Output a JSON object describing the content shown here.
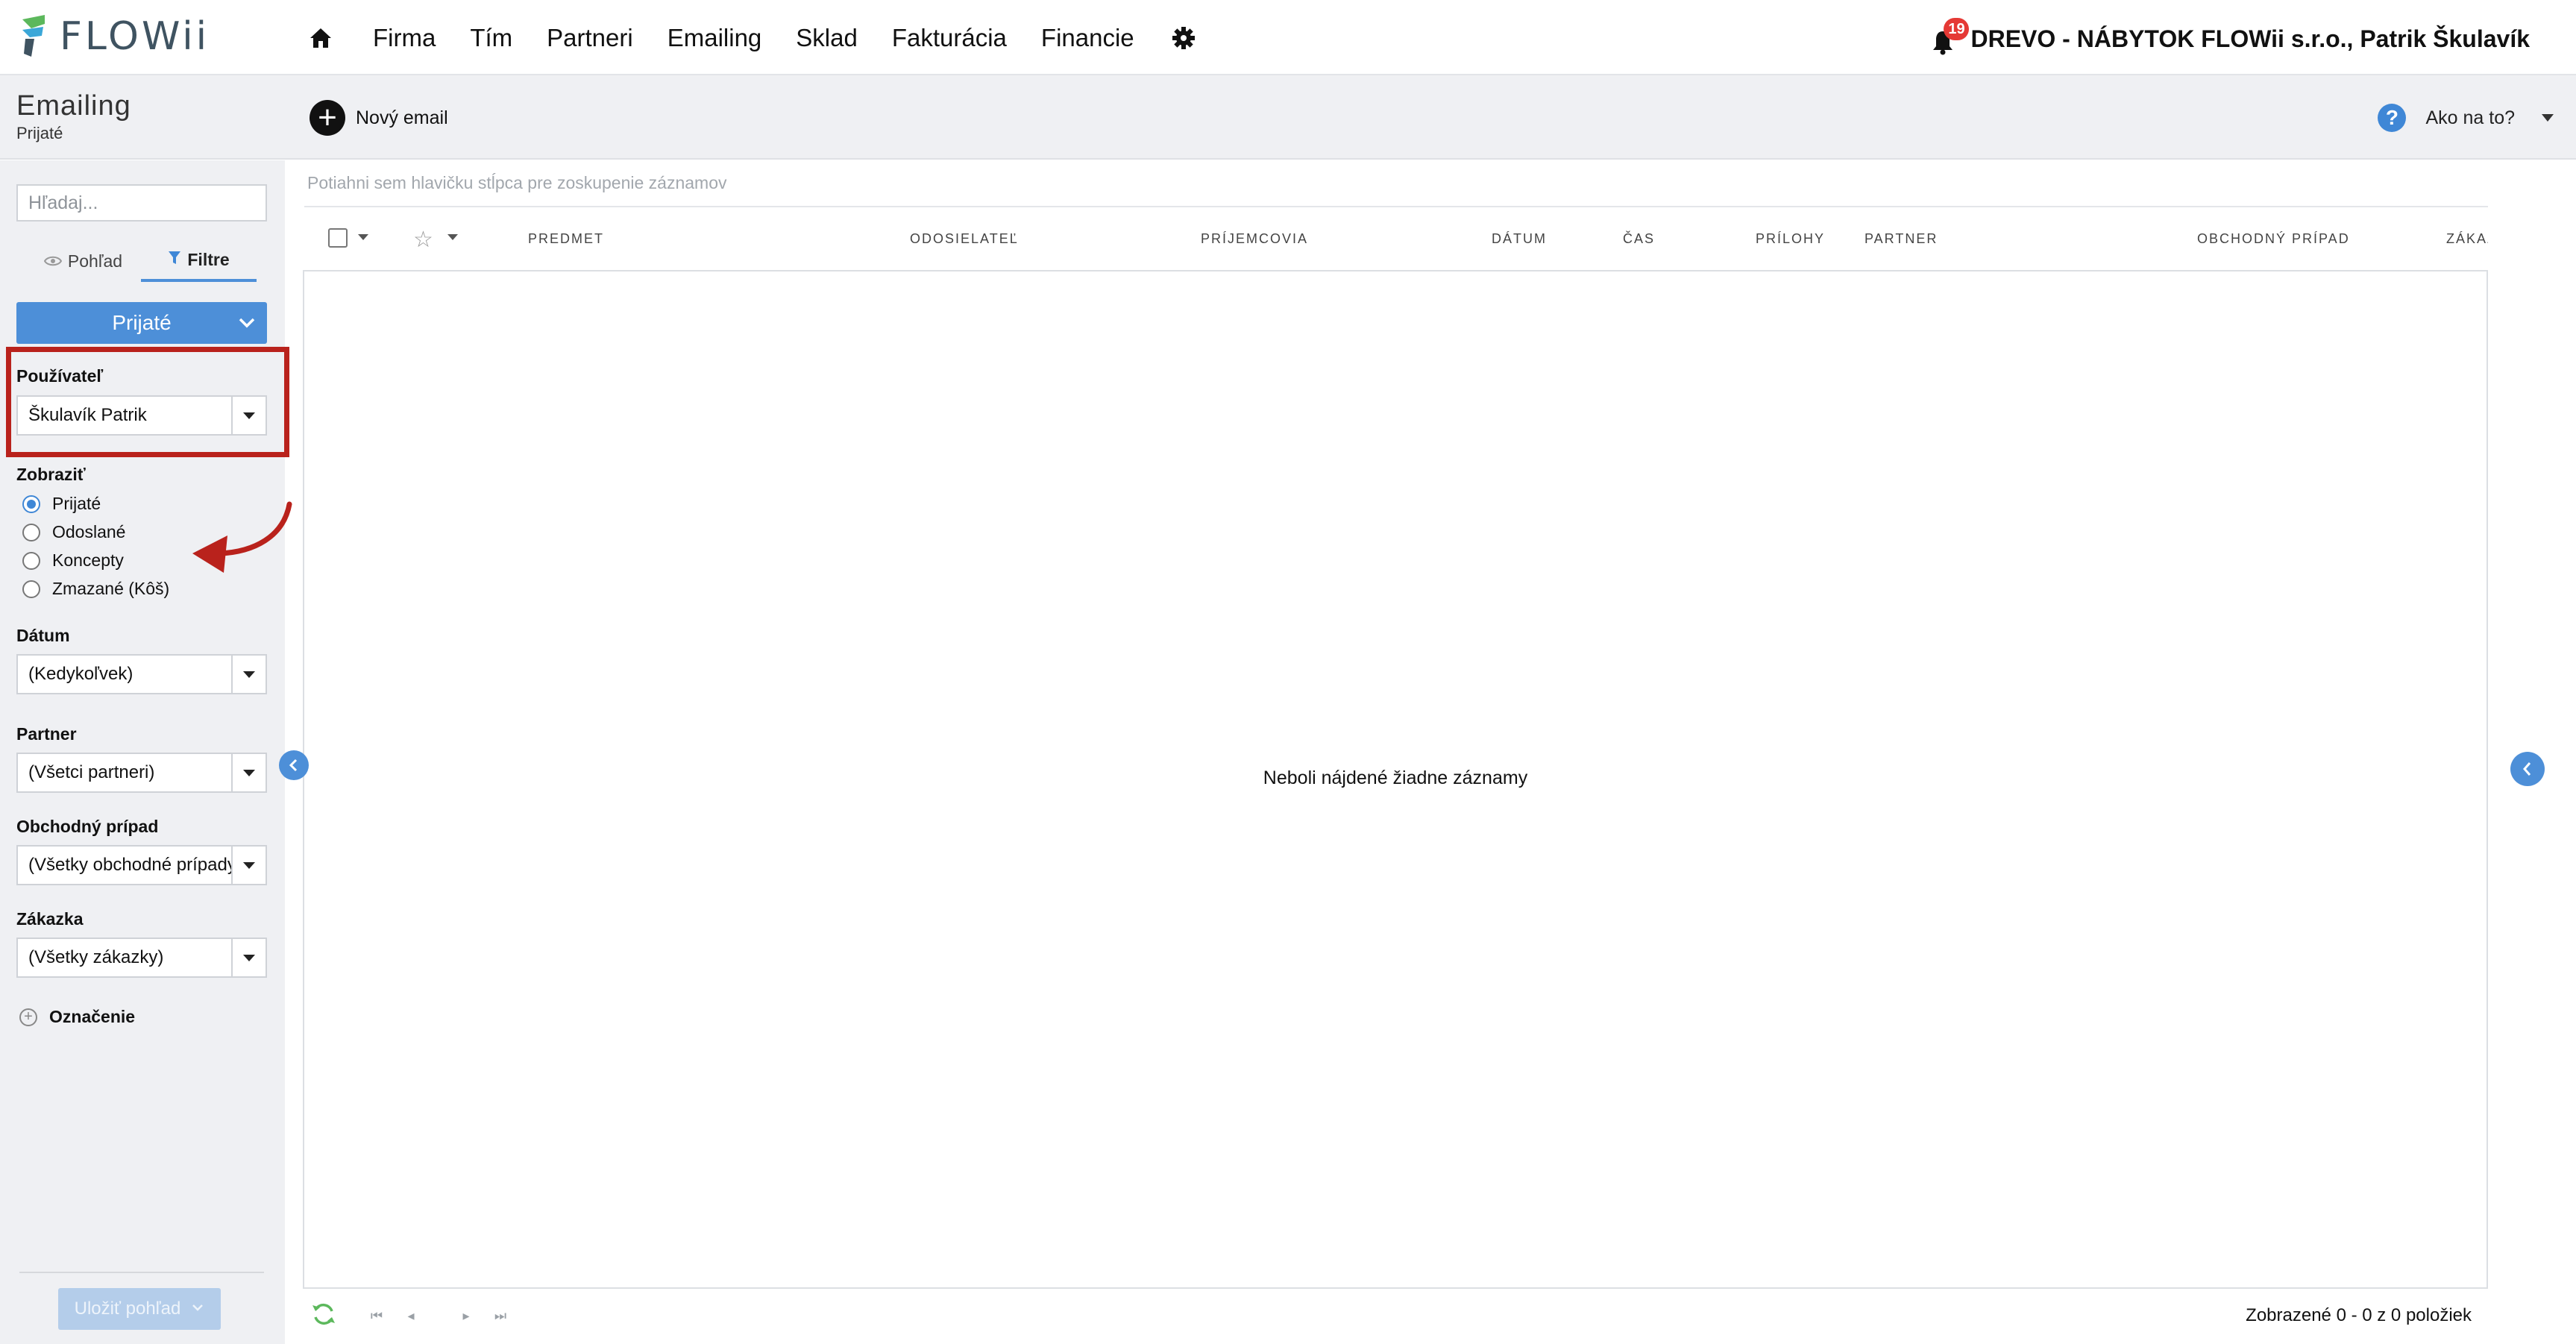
{
  "app": {
    "logo_text": "FLOWii",
    "company_user": "DREVO - NÁBYTOK FLOWii s.r.o., Patrik Škulavík",
    "notifications_count": "19"
  },
  "nav": {
    "items": [
      {
        "label": "Firma"
      },
      {
        "label": "Tím"
      },
      {
        "label": "Partneri"
      },
      {
        "label": "Emailing"
      },
      {
        "label": "Sklad"
      },
      {
        "label": "Fakturácia"
      },
      {
        "label": "Financie"
      }
    ]
  },
  "header": {
    "module_title": "Emailing",
    "module_subtitle": "Prijaté",
    "new_email_label": "Nový email",
    "help_label": "Ako na to?"
  },
  "sidebar": {
    "search_placeholder": "Hľadaj...",
    "tab_view": "Pohľad",
    "tab_filters": "Filtre",
    "folder_button": "Prijaté",
    "user_label": "Používateľ",
    "user_value": "Škulavík Patrik",
    "show_label": "Zobraziť",
    "show_options": [
      {
        "label": "Prijaté",
        "checked": true
      },
      {
        "label": "Odoslané",
        "checked": false
      },
      {
        "label": "Koncepty",
        "checked": false
      },
      {
        "label": "Zmazané (Kôš)",
        "checked": false
      }
    ],
    "date_label": "Dátum",
    "date_value": "(Kedykoľvek)",
    "partner_label": "Partner",
    "partner_value": "(Všetci partneri)",
    "case_label": "Obchodný prípad",
    "case_value": "(Všetky obchodné prípady)",
    "order_label": "Zákazka",
    "order_value": "(Všetky zákazky)",
    "tag_label": "Označenie",
    "save_view_label": "Uložiť pohľad"
  },
  "grid": {
    "group_hint": "Potiahni sem hlavičku stĺpca pre zoskupenie záznamov",
    "columns": [
      {
        "label": "PREDMET"
      },
      {
        "label": "ODOSIELATEĽ"
      },
      {
        "label": "PRÍJEMCOVIA"
      },
      {
        "label": "DÁTUM"
      },
      {
        "label": "ČAS"
      },
      {
        "label": "PRÍLOHY"
      },
      {
        "label": "PARTNER"
      },
      {
        "label": "OBCHODNÝ PRÍPAD"
      },
      {
        "label": "ZÁKAZ"
      }
    ],
    "empty_message": "Neboli nájdené žiadne záznamy",
    "footer_info": "Zobrazené 0 - 0 z 0 položiek"
  },
  "colors": {
    "accent": "#4d8fd8",
    "annotation": "#b9221c",
    "badge": "#e53935"
  }
}
